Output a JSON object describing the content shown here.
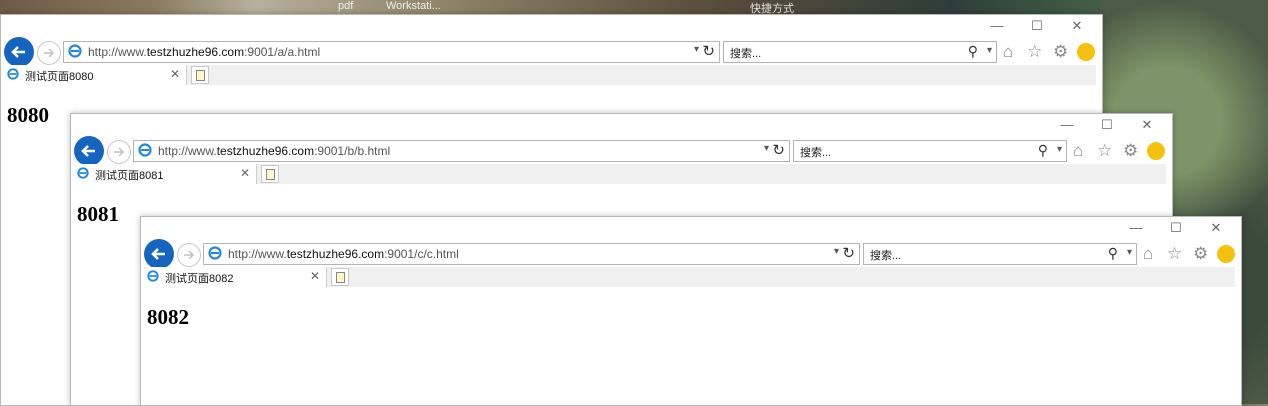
{
  "desktop": {
    "taskbar_texts": [
      "pdf",
      "Workstati...",
      "快捷方式"
    ]
  },
  "windows": [
    {
      "url_prefix": "http://www.",
      "url_domain": "testzhuzhe96.com",
      "url_suffix": ":9001/a/a.html",
      "search_placeholder": "搜索...",
      "tab_title": "测试页面8080",
      "heading": "8080",
      "caption": {
        "minimize": "—",
        "maximize": "☐",
        "close": "✕"
      }
    },
    {
      "url_prefix": "http://www.",
      "url_domain": "testzhuzhe96.com",
      "url_suffix": ":9001/b/b.html",
      "search_placeholder": "搜索...",
      "tab_title": "测试页面8081",
      "heading": "8081",
      "caption": {
        "minimize": "—",
        "maximize": "☐",
        "close": "✕"
      }
    },
    {
      "url_prefix": "http://www.",
      "url_domain": "testzhuzhe96.com",
      "url_suffix": ":9001/c/c.html",
      "search_placeholder": "搜索...",
      "tab_title": "测试页面8082",
      "heading": "8082",
      "caption": {
        "minimize": "—",
        "maximize": "☐",
        "close": "✕"
      }
    }
  ],
  "icons": {
    "back": "back-arrow-icon",
    "forward": "forward-arrow-icon",
    "ie": "ie-logo-icon",
    "refresh": "refresh-icon",
    "search": "magnifier-icon",
    "home": "home-icon",
    "favorites": "star-icon",
    "settings": "gear-icon",
    "feedback": "smiley-icon"
  },
  "colors": {
    "accent": "#1565c0",
    "ie_logo": "#1e88e5"
  }
}
